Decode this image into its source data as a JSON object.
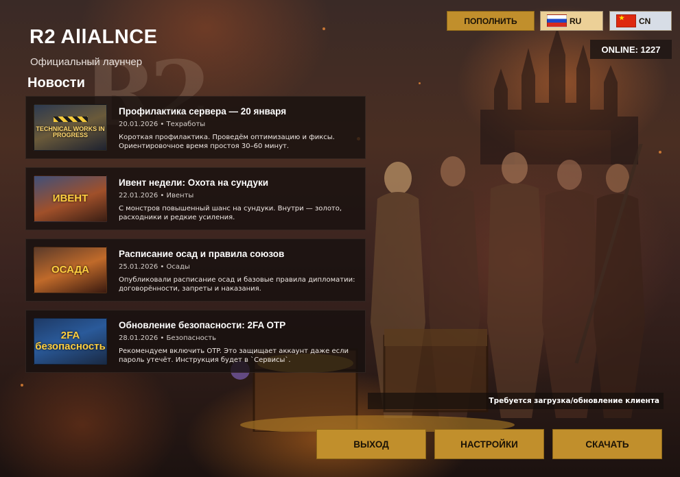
{
  "header": {
    "title": "R2 AllALNCE",
    "subtitle": "Официальный лаунчер",
    "news_heading": "Новости"
  },
  "topbar": {
    "topup_label": "ПОПОЛНИТЬ",
    "languages": [
      {
        "code": "RU",
        "flag": "ru-flag-icon"
      },
      {
        "code": "CN",
        "flag": "cn-flag-icon"
      }
    ],
    "online_text": "ONLINE: 1227"
  },
  "news": [
    {
      "title": "Профилактика сервера — 20 января",
      "meta": "20.01.2026 • Техработы",
      "text": "Короткая профилактика. Проведём оптимизацию и фиксы. Ориентировочное время простоя 30–60 минут.",
      "thumb_caption": "TECHNICAL WORKS IN PROGRESS"
    },
    {
      "title": "Ивент недели: Охота на сундуки",
      "meta": "22.01.2026 • Ивенты",
      "text": "С монстров повышенный шанс на сундуки. Внутри — золото, расходники и редкие усиления.",
      "thumb_caption": "ИВЕНТ"
    },
    {
      "title": "Расписание осад и правила союзов",
      "meta": "25.01.2026 • Осады",
      "text": "Опубликовали расписание осад и базовые правила дипломатии: договорённости, запреты и наказания.",
      "thumb_caption": "ОСАДА"
    },
    {
      "title": "Обновление безопасности: 2FA OTP",
      "meta": "28.01.2026 • Безопасность",
      "text": "Рекомендуем включить OTP. Это защищает аккаунт даже если пароль утечёт. Инструкция будет в `Сервисы`.",
      "thumb_caption": "2FA безопасность"
    }
  ],
  "status": {
    "text": "Требуется загрузка/обновление клиента"
  },
  "actions": {
    "exit_label": "ВЫХОД",
    "settings_label": "НАСТРОЙКИ",
    "download_label": "СКАЧАТЬ"
  },
  "colors": {
    "accent": "#c18f2c",
    "panel": "#16100e",
    "lang_ru_bg": "#ecd097",
    "lang_cn_bg": "#d7dde6"
  }
}
